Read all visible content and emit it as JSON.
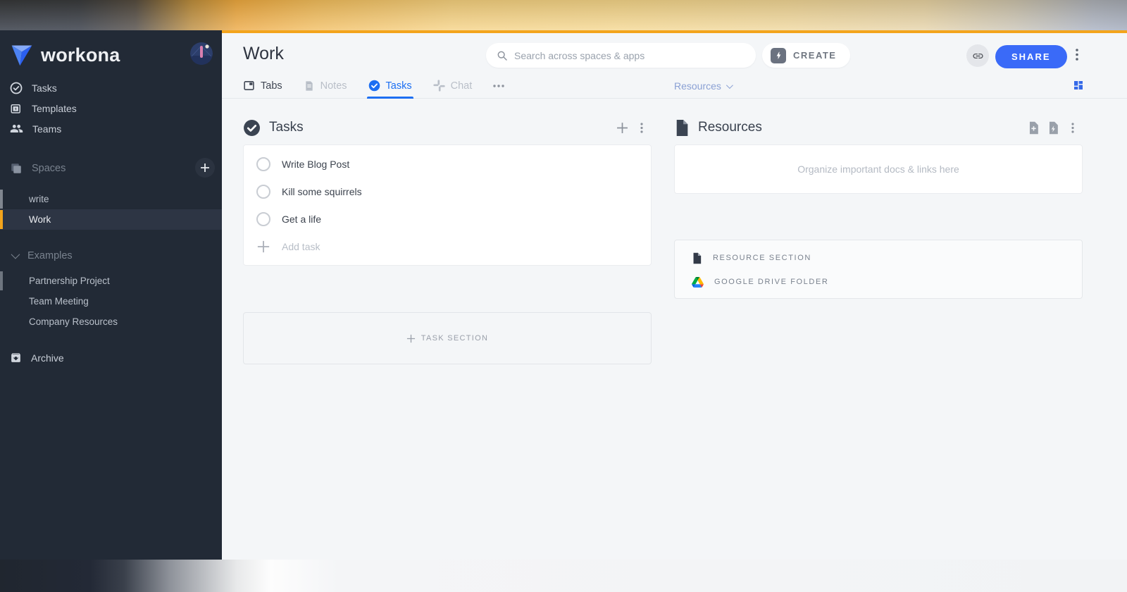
{
  "sidebar": {
    "logo_text": "workona",
    "nav": [
      {
        "label": "Tasks"
      },
      {
        "label": "Templates"
      },
      {
        "label": "Teams"
      }
    ],
    "spaces_header": {
      "label": "Spaces"
    },
    "spaces": [
      {
        "label": "write",
        "active": false,
        "tag_color": "#80868f"
      },
      {
        "label": "Work",
        "active": true,
        "tag_color": "#f3a41c"
      }
    ],
    "examples_header": {
      "label": "Examples"
    },
    "examples": [
      {
        "label": "Partnership Project",
        "tag_color": "#6e757f"
      },
      {
        "label": "Team Meeting"
      },
      {
        "label": "Company Resources"
      }
    ],
    "archive_label": "Archive"
  },
  "header": {
    "title": "Work",
    "search_placeholder": "Search across spaces & apps",
    "create_label": "CREATE",
    "share_label": "SHARE"
  },
  "tabs": {
    "items": [
      {
        "label": "Tabs",
        "active": false
      },
      {
        "label": "Notes",
        "active": false
      },
      {
        "label": "Tasks",
        "active": true
      },
      {
        "label": "Chat",
        "active": false
      }
    ],
    "resources_dropdown_label": "Resources"
  },
  "tasks_panel": {
    "title": "Tasks",
    "items": [
      "Write Blog Post",
      "Kill some squirrels",
      "Get a life"
    ],
    "add_task_placeholder": "Add task",
    "add_section_label": "TASK SECTION"
  },
  "resources_panel": {
    "title": "Resources",
    "empty_placeholder": "Organize important docs & links here",
    "sections": [
      {
        "label": "RESOURCE SECTION",
        "icon": "document-icon"
      },
      {
        "label": "GOOGLE DRIVE FOLDER",
        "icon": "google-drive-icon"
      }
    ]
  },
  "colors": {
    "accent_amber": "#f3a41c",
    "active_tab_blue": "#1d6ff2",
    "share_blue": "#3a6af8",
    "sidebar_bg": "#222a36"
  }
}
